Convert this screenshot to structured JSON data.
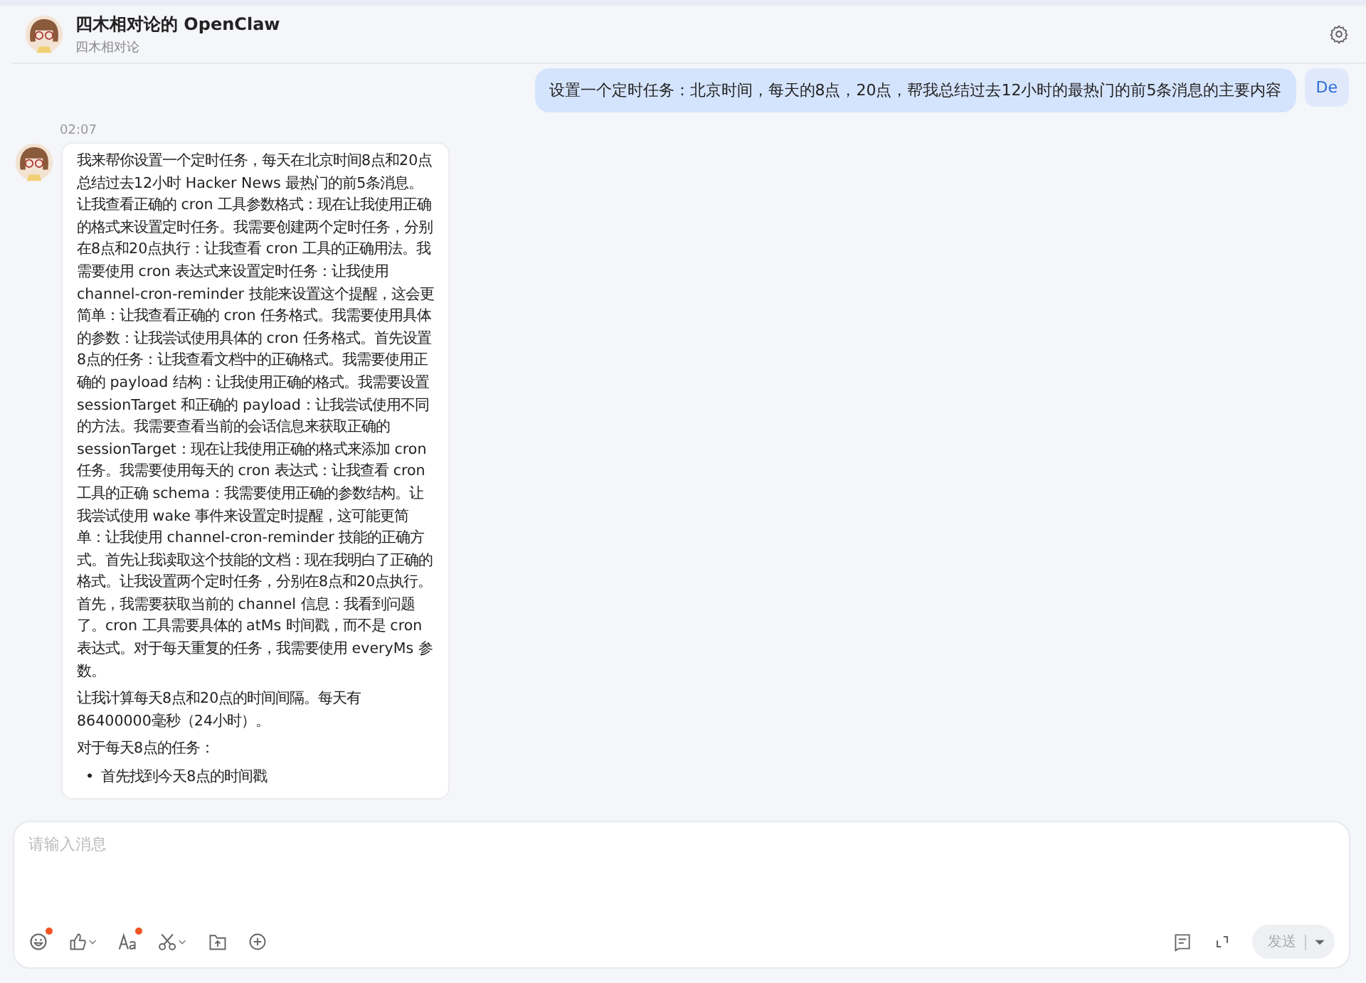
{
  "header": {
    "title": "四木相对论的 OpenClaw",
    "subtitle": "四木相对论"
  },
  "user_message": {
    "text": "设置一个定时任务：北京时间，每天的8点，20点，帮我总结过去12小时的最热门的前5条消息的主要内容",
    "avatar": "De"
  },
  "bot_message": {
    "time": "02:07",
    "paragraphs": [
      "我来帮你设置一个定时任务，每天在北京时间8点和20点总结过去12小时 Hacker News 最热门的前5条消息。让我查看正确的 cron 工具参数格式：现在让我使用正确的格式来设置定时任务。我需要创建两个定时任务，分别在8点和20点执行：让我查看 cron 工具的正确用法。我需要使用 cron 表达式来设置定时任务：让我使用 channel-cron-reminder 技能来设置这个提醒，这会更简单：让我查看正确的 cron 任务格式。我需要使用具体的参数：让我尝试使用具体的 cron 任务格式。首先设置8点的任务：让我查看文档中的正确格式。我需要使用正确的 payload 结构：让我使用正确的格式。我需要设置 sessionTarget 和正确的 payload：让我尝试使用不同的方法。我需要查看当前的会话信息来获取正确的 sessionTarget：现在让我使用正确的格式来添加 cron 任务。我需要使用每天的 cron 表达式：让我查看 cron 工具的正确 schema：我需要使用正确的参数结构。让我尝试使用 wake 事件来设置定时提醒，这可能更简单：让我使用 channel-cron-reminder 技能的正确方式。首先让我读取这个技能的文档：现在我明白了正确的格式。让我设置两个定时任务，分别在8点和20点执行。首先，我需要获取当前的 channel 信息：我看到问题了。cron 工具需要具体的 atMs 时间戳，而不是 cron 表达式。对于每天重复的任务，我需要使用 everyMs 参数。",
      "让我计算每天8点和20点的时间间隔。每天有 86400000毫秒（24小时）。",
      "对于每天8点的任务："
    ],
    "bullets": [
      {
        "marker": "•",
        "text": "首先找到今天8点的时间戳"
      }
    ]
  },
  "composer": {
    "placeholder": "请输入消息",
    "tools": [
      {
        "kind": "emoji",
        "badge": true
      },
      {
        "kind": "like",
        "badge": false
      },
      {
        "kind": "font",
        "badge": true
      },
      {
        "kind": "scissors",
        "badge": false
      },
      {
        "kind": "folder",
        "badge": false
      },
      {
        "kind": "plus",
        "badge": false
      }
    ],
    "send": {
      "label": "发送",
      "disabled": true
    }
  }
}
